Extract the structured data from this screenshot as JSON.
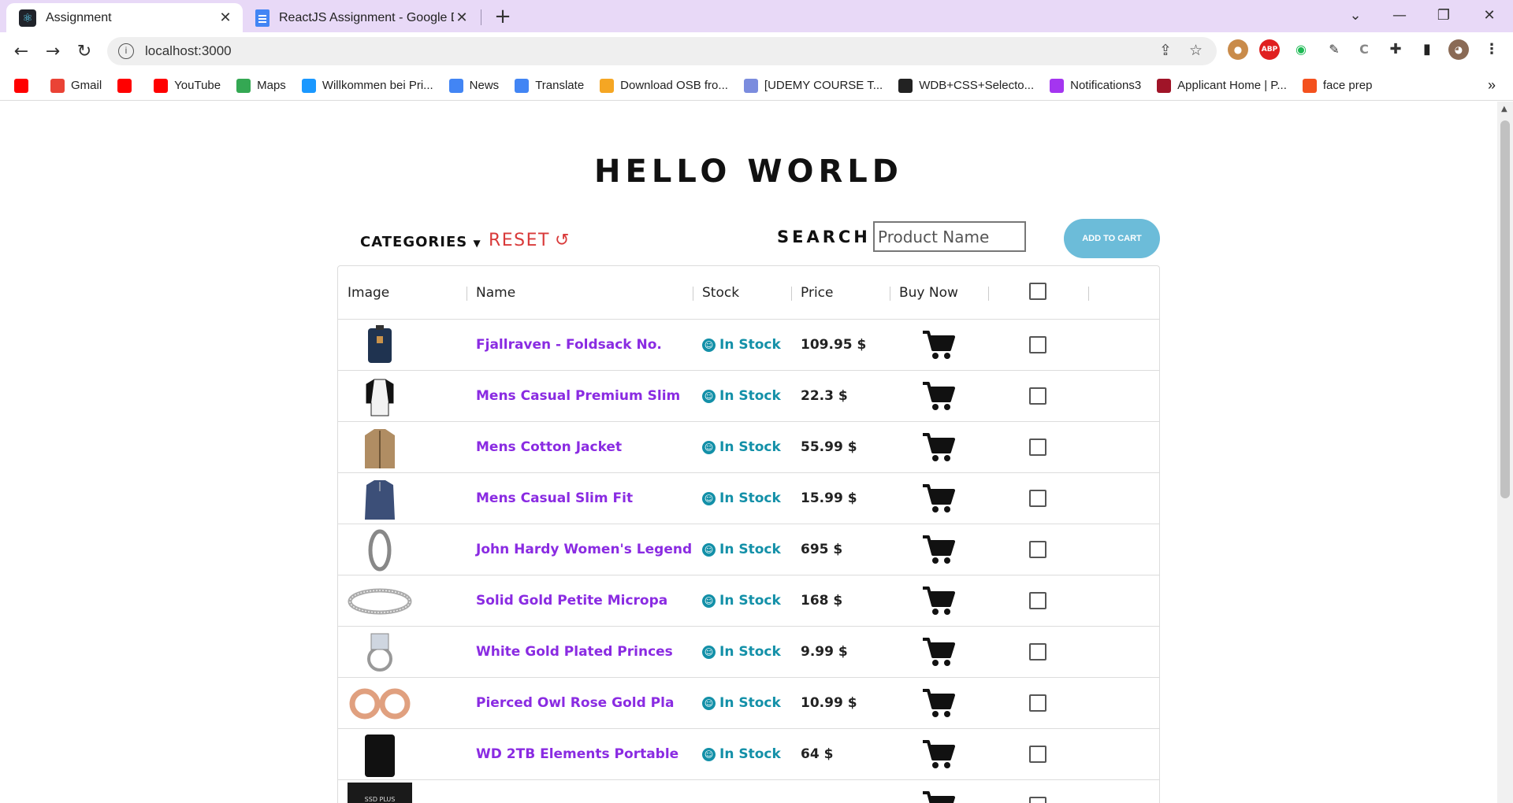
{
  "browser": {
    "tabs": [
      {
        "title": "Assignment",
        "active": true
      },
      {
        "title": "ReactJS Assignment - Google Do",
        "active": false
      }
    ],
    "url": "localhost:3000",
    "bookmarks": [
      {
        "label": "",
        "icon": "youtube-icon",
        "color": "#ff0000"
      },
      {
        "label": "Gmail",
        "icon": "gmail-icon",
        "color": "#ea4335"
      },
      {
        "label": "",
        "icon": "youtube-icon",
        "color": "#ff0000"
      },
      {
        "label": "YouTube",
        "icon": "youtube-icon",
        "color": "#ff0000"
      },
      {
        "label": "Maps",
        "icon": "maps-icon",
        "color": "#34a853"
      },
      {
        "label": "Willkommen bei Pri...",
        "icon": "prime-icon",
        "color": "#1a98ff"
      },
      {
        "label": "News",
        "icon": "news-icon",
        "color": "#4285f4"
      },
      {
        "label": "Translate",
        "icon": "translate-icon",
        "color": "#4285f4"
      },
      {
        "label": "Download OSB fro...",
        "icon": "diamond-icon",
        "color": "#f5a623"
      },
      {
        "label": "[UDEMY COURSE T...",
        "icon": "udemy-icon",
        "color": "#7b8cde"
      },
      {
        "label": "WDB+CSS+Selecto...",
        "icon": "globe-icon",
        "color": "#222222"
      },
      {
        "label": "Notifications3",
        "icon": "notifications-icon",
        "color": "#a435f0"
      },
      {
        "label": "Applicant Home | P...",
        "icon": "applicant-icon",
        "color": "#a01428"
      },
      {
        "label": "face prep",
        "icon": "faceprep-icon",
        "color": "#f4511e"
      }
    ]
  },
  "page": {
    "title": "HELLO WORLD",
    "categories_label": "CATEGORIES",
    "reset_label": "RESET",
    "search_label": "SEARCH :",
    "search_placeholder": "Product Name",
    "add_to_cart_label": "ADD TO CART",
    "accent_color": "#6cbcd9",
    "product_name_color": "#8a2be2",
    "stock_color": "#1390a8",
    "reset_color": "#d93a3a"
  },
  "table": {
    "headers": {
      "image": "Image",
      "name": "Name",
      "stock": "Stock",
      "price": "Price",
      "buy": "Buy Now"
    },
    "rows": [
      {
        "name": "Fjallraven - Foldsack No.",
        "stock": "In Stock",
        "price": "109.95 $",
        "image": "backpack"
      },
      {
        "name": "Mens Casual Premium Slim",
        "stock": "In Stock",
        "price": "22.3 $",
        "image": "raglan-shirt"
      },
      {
        "name": "Mens Cotton Jacket",
        "stock": "In Stock",
        "price": "55.99 $",
        "image": "jacket"
      },
      {
        "name": "Mens Casual Slim Fit",
        "stock": "In Stock",
        "price": "15.99 $",
        "image": "longsleeve"
      },
      {
        "name": "John Hardy Women's Legend",
        "stock": "In Stock",
        "price": "695 $",
        "image": "bracelet"
      },
      {
        "name": "Solid Gold Petite Micropa",
        "stock": "In Stock",
        "price": "168 $",
        "image": "ring-band"
      },
      {
        "name": "White Gold Plated Princes",
        "stock": "In Stock",
        "price": "9.99 $",
        "image": "ring"
      },
      {
        "name": "Pierced Owl Rose Gold Pla",
        "stock": "In Stock",
        "price": "10.99 $",
        "image": "plugs"
      },
      {
        "name": "WD 2TB Elements Portable",
        "stock": "In Stock",
        "price": "64 $",
        "image": "hdd"
      },
      {
        "name": "",
        "stock": "",
        "price": "",
        "image": "ssd"
      }
    ]
  }
}
